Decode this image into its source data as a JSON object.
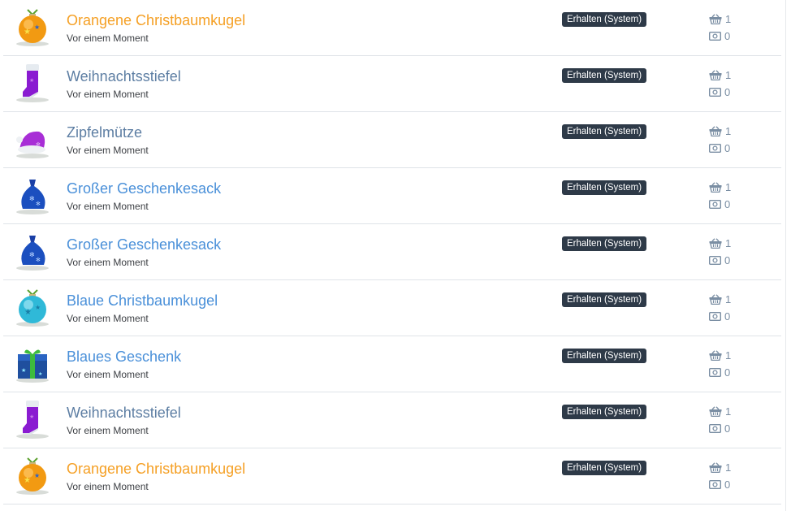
{
  "items": [
    {
      "name": "Orangene Christbaumkugel",
      "time": "Vor einem Moment",
      "badge": "Erhalten (System)",
      "count": "1",
      "price": "0",
      "icon": "orange-ornament-icon",
      "style": "orange"
    },
    {
      "name": "Weihnachtsstiefel",
      "time": "Vor einem Moment",
      "badge": "Erhalten (System)",
      "count": "1",
      "price": "0",
      "icon": "christmas-stocking-icon",
      "style": "grey"
    },
    {
      "name": "Zipfelmütze",
      "time": "Vor einem Moment",
      "badge": "Erhalten (System)",
      "count": "1",
      "price": "0",
      "icon": "santa-hat-icon",
      "style": "grey"
    },
    {
      "name": "Großer Geschenkesack",
      "time": "Vor einem Moment",
      "badge": "Erhalten (System)",
      "count": "1",
      "price": "0",
      "icon": "gift-sack-icon",
      "style": "blue"
    },
    {
      "name": "Großer Geschenkesack",
      "time": "Vor einem Moment",
      "badge": "Erhalten (System)",
      "count": "1",
      "price": "0",
      "icon": "gift-sack-icon",
      "style": "blue"
    },
    {
      "name": "Blaue Christbaumkugel",
      "time": "Vor einem Moment",
      "badge": "Erhalten (System)",
      "count": "1",
      "price": "0",
      "icon": "blue-ornament-icon",
      "style": "blue"
    },
    {
      "name": "Blaues Geschenk",
      "time": "Vor einem Moment",
      "badge": "Erhalten (System)",
      "count": "1",
      "price": "0",
      "icon": "blue-gift-box-icon",
      "style": "blue"
    },
    {
      "name": "Weihnachtsstiefel",
      "time": "Vor einem Moment",
      "badge": "Erhalten (System)",
      "count": "1",
      "price": "0",
      "icon": "christmas-stocking-icon",
      "style": "grey"
    },
    {
      "name": "Orangene Christbaumkugel",
      "time": "Vor einem Moment",
      "badge": "Erhalten (System)",
      "count": "1",
      "price": "0",
      "icon": "orange-ornament-icon",
      "style": "orange"
    }
  ],
  "colors": {
    "orange_name": "#f5a025",
    "grey_name": "#5d7ea3",
    "blue_name": "#4a90d9",
    "badge_bg": "#2e3a48",
    "stat": "#7a8ea3"
  }
}
